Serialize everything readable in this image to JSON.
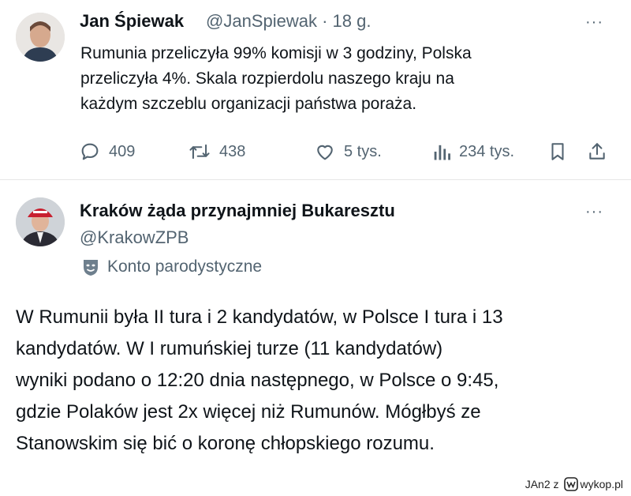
{
  "tweet1": {
    "author_name": "Jan Śpiewak",
    "handle_time": "@JanSpiewak · 18 g.",
    "text_lines": [
      "Rumunia przeliczyła 99% komisji w 3 godziny, Polska",
      "przeliczyła 4%. Skala rozpierdolu naszego kraju na",
      "każdym szczeblu organizacji państwa poraża."
    ],
    "actions": {
      "replies": "409",
      "reposts": "438",
      "likes": "5 tys.",
      "views": "234 tys."
    },
    "more": "···"
  },
  "tweet2": {
    "author_name": "Kraków żąda przynajmniej Bukaresztu",
    "handle": "@KrakowZPB",
    "parody_label": "Konto parodystyczne",
    "more": "···",
    "text_lines": [
      "W Rumunii była II tura i 2 kandydatów, w Polsce I tura i 13",
      "kandydatów. W I rumuńskiej turze (11 kandydatów)",
      "wyniki podano o 12:20 dnia następnego, w Polsce o 9:45,",
      "gdzie Polaków jest 2x więcej niż Rumunów. Mógłbyś ze",
      "Stanowskim się bić o koronę chłopskiego rozumu."
    ]
  },
  "watermark": {
    "user": "JAn2 z",
    "site": "wykop.pl"
  },
  "icons": {
    "reply": "reply-icon",
    "repost": "repost-icon",
    "like": "heart-icon",
    "views": "views-icon",
    "bookmark": "bookmark-icon",
    "share": "share-icon",
    "parody": "parody-mask-icon"
  }
}
